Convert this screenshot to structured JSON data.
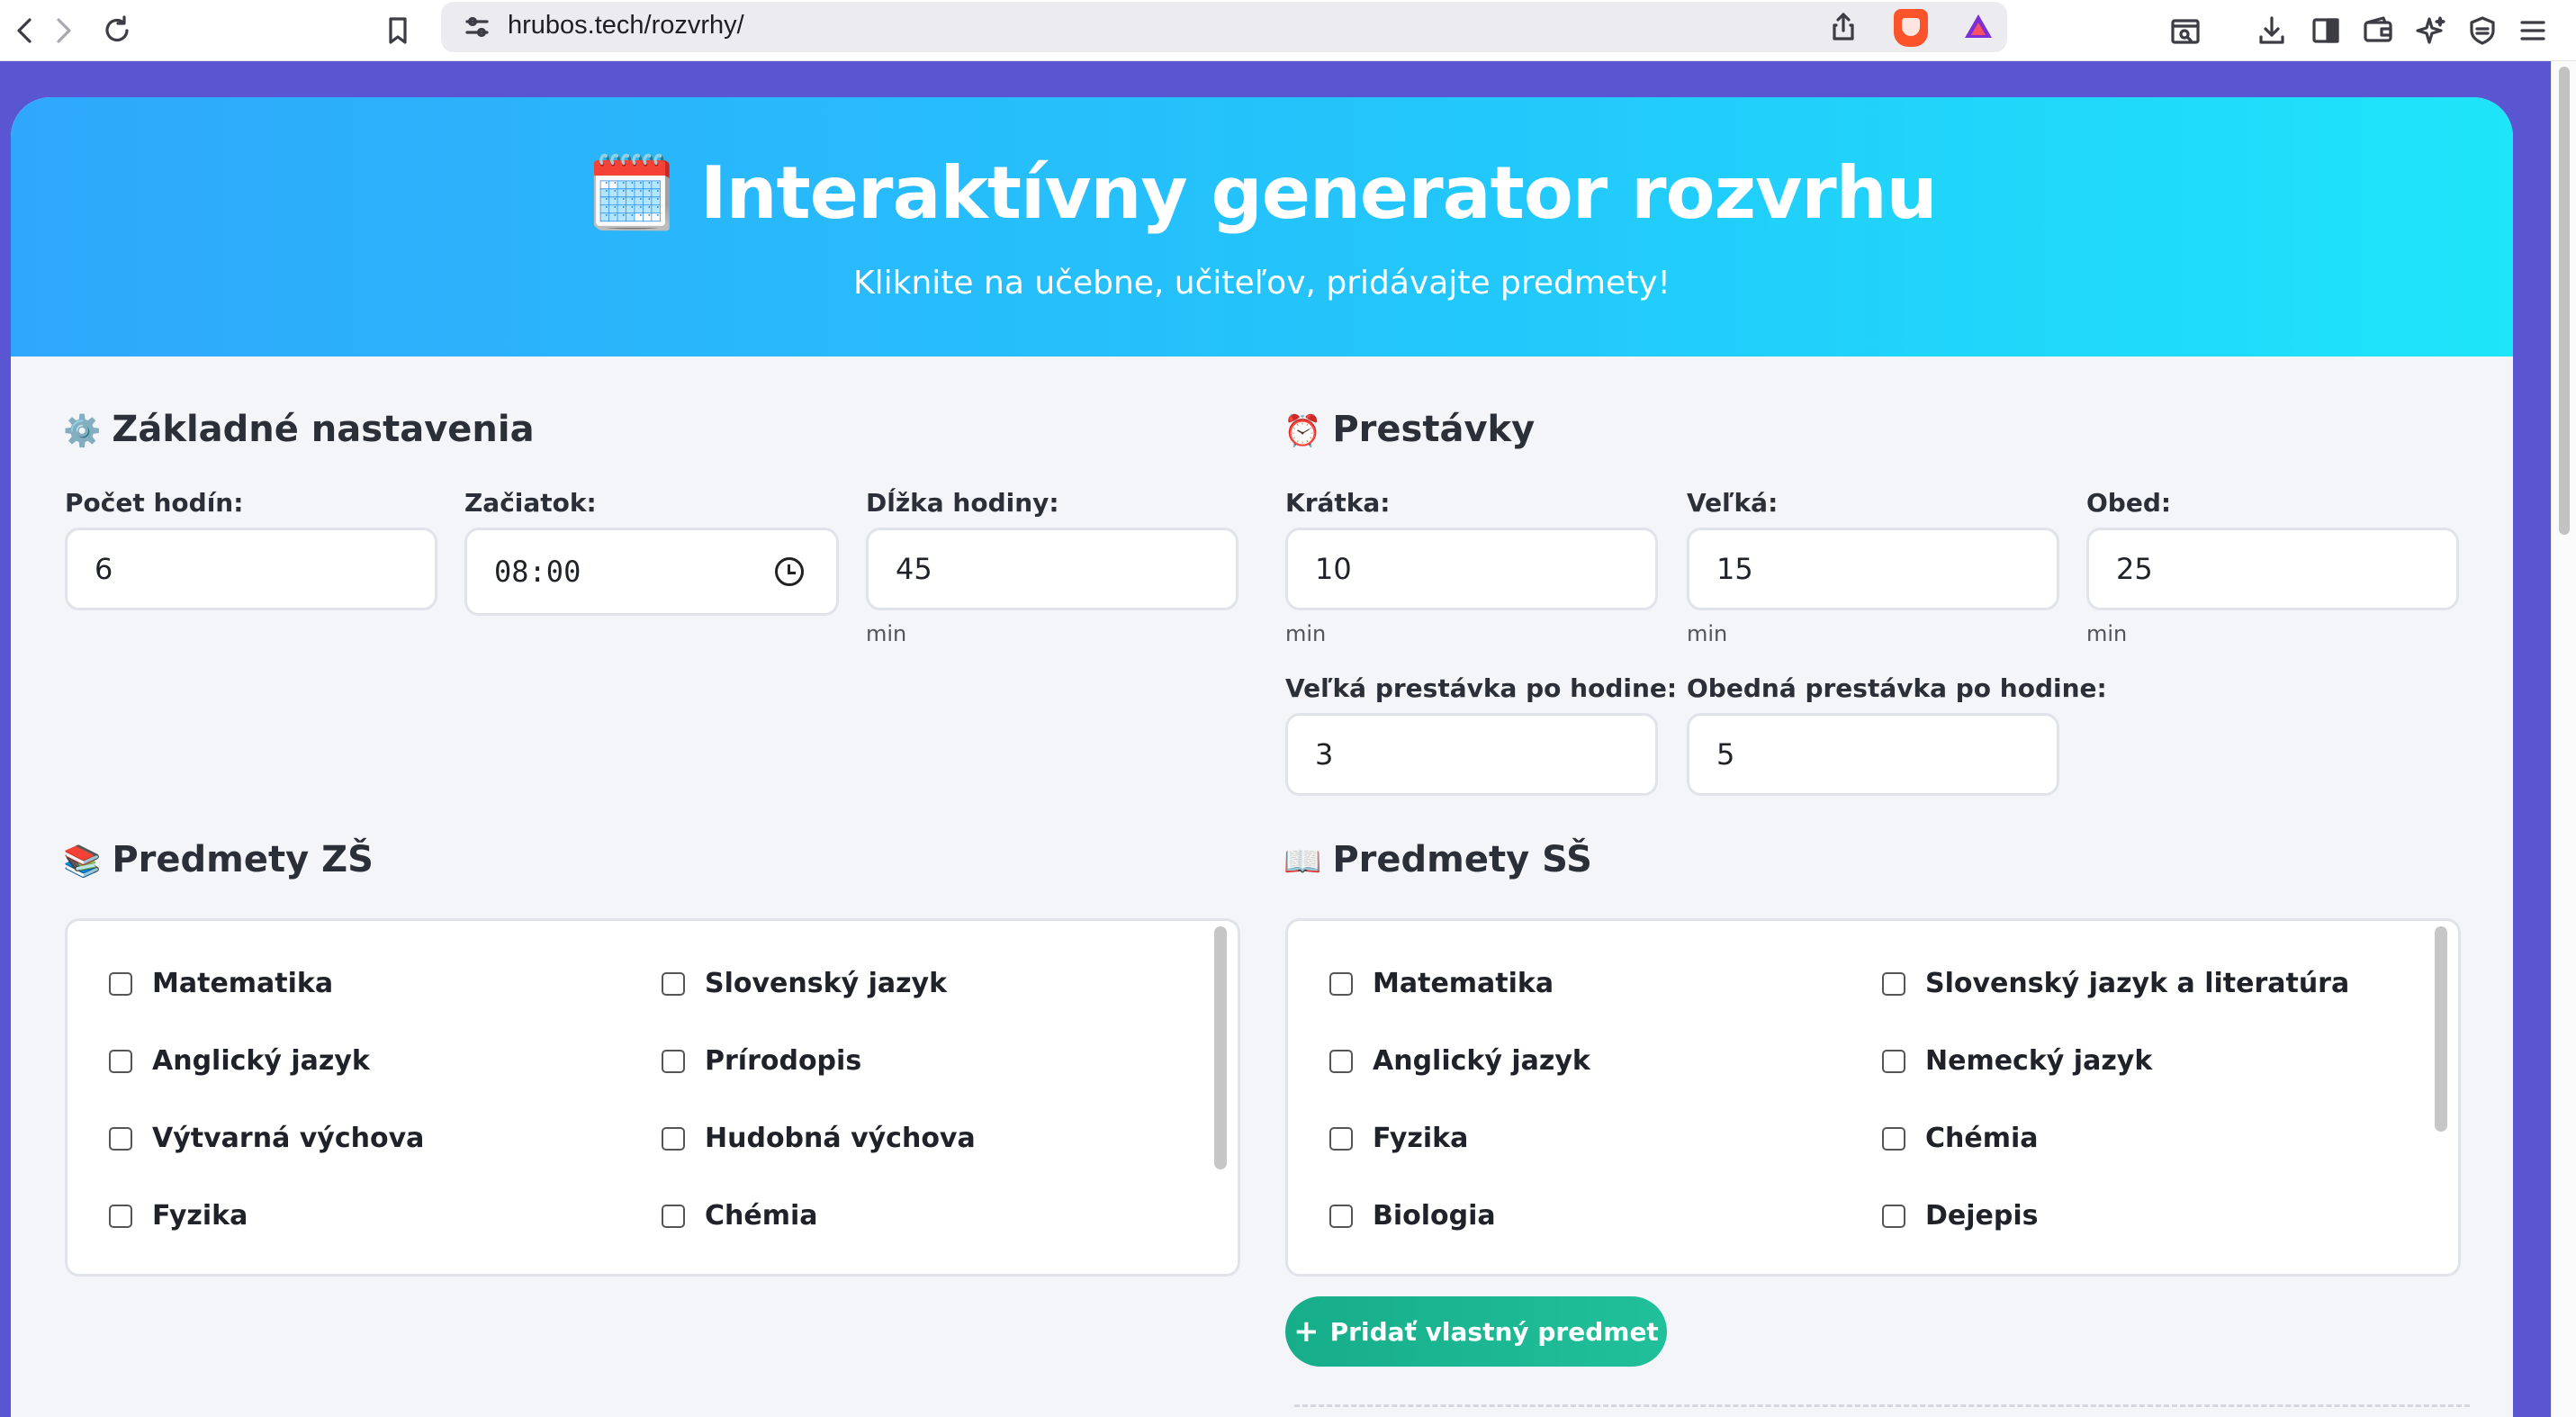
{
  "browser": {
    "url": "hrubos.tech/rozvrhy/",
    "icons": [
      "back-icon",
      "forward-icon",
      "reload-icon",
      "bookmark-icon",
      "site-settings-icon",
      "share-icon",
      "brave-shields-icon",
      "brave-rewards-icon",
      "reader-mode-icon",
      "downloads-icon",
      "sidebar-icon",
      "wallet-icon",
      "leo-ai-icon",
      "vpn-icon",
      "menu-icon"
    ]
  },
  "header": {
    "emoji": "🗓️",
    "title": "Interaktívny generator rozvrhu",
    "subtitle": "Kliknite na učebne, učiteľov, pridávajte predmety!"
  },
  "basic": {
    "emoji": "⚙️",
    "title": "Základné nastavenia",
    "lessons_label": "Počet hodín:",
    "lessons_value": "6",
    "start_label": "Začiatok:",
    "start_value": "08:00",
    "length_label": "Dĺžka hodiny:",
    "length_value": "45",
    "length_unit": "min"
  },
  "breaks": {
    "emoji": "⏰",
    "title": "Prestávky",
    "short_label": "Krátka:",
    "short_value": "10",
    "short_unit": "min",
    "long_label": "Veľká:",
    "long_value": "15",
    "long_unit": "min",
    "lunch_label": "Obed:",
    "lunch_value": "25",
    "lunch_unit": "min",
    "long_after_label": "Veľká prestávka po hodine:",
    "long_after_value": "3",
    "lunch_after_label": "Obedná prestávka po hodine:",
    "lunch_after_value": "5"
  },
  "zs": {
    "emoji": "📚",
    "title": "Predmety ZŠ",
    "subjects": [
      "Matematika",
      "Slovenský jazyk",
      "Anglický jazyk",
      "Prírodopis",
      "Výtvarná výchova",
      "Hudobná výchova",
      "Fyzika",
      "Chémia"
    ],
    "scroll_position": 0.0
  },
  "ss": {
    "emoji": "📖",
    "title": "Predmety SŠ",
    "subjects": [
      "Matematika",
      "Slovenský jazyk a literatúra",
      "Anglický jazyk",
      "Nemecký jazyk",
      "Fyzika",
      "Chémia",
      "Biologia",
      "Dejepis"
    ],
    "scroll_position": 0.0,
    "add_label": "Pridať vlastný predmet",
    "add_icon": "+"
  }
}
